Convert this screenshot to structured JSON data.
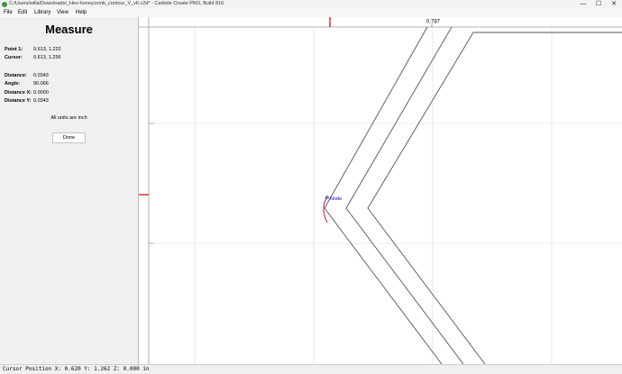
{
  "window": {
    "title": "C:/Users/willa/Downloads/_Hex-honeycomb_contour_V_v6.c2d* - Carbide Create PRO, Build 816",
    "controls": {
      "minimize": "—",
      "maximize": "☐",
      "close": "✕"
    }
  },
  "menu": [
    "File",
    "Edit",
    "Library",
    "View",
    "Help"
  ],
  "measure": {
    "title": "Measure",
    "point1_label": "Point 1:",
    "point1_value": "0.613, 1.222",
    "cursor_label": "Cursor:",
    "cursor_value": "0.613, 1.256",
    "distance_label": "Distance:",
    "distance_value": "0.0343",
    "angle_label": "Angle:",
    "angle_value": "90.066",
    "dx_label": "Distance X:",
    "dx_value": "0.0000",
    "dy_label": "Distance Y:",
    "dy_value": "0.0343",
    "units_note": "All units are inch",
    "done_label": "Done"
  },
  "canvas": {
    "ruler_value": "0.787",
    "node_label": "Node",
    "colors": {
      "grid": "#d8d8d8",
      "ruler_marker": "#cc0000",
      "node_label": "#0000cc",
      "shape": "#555555"
    }
  },
  "status": {
    "text": "Cursor Position X: 0.620 Y: 1.262 Z: 0.000 in"
  }
}
